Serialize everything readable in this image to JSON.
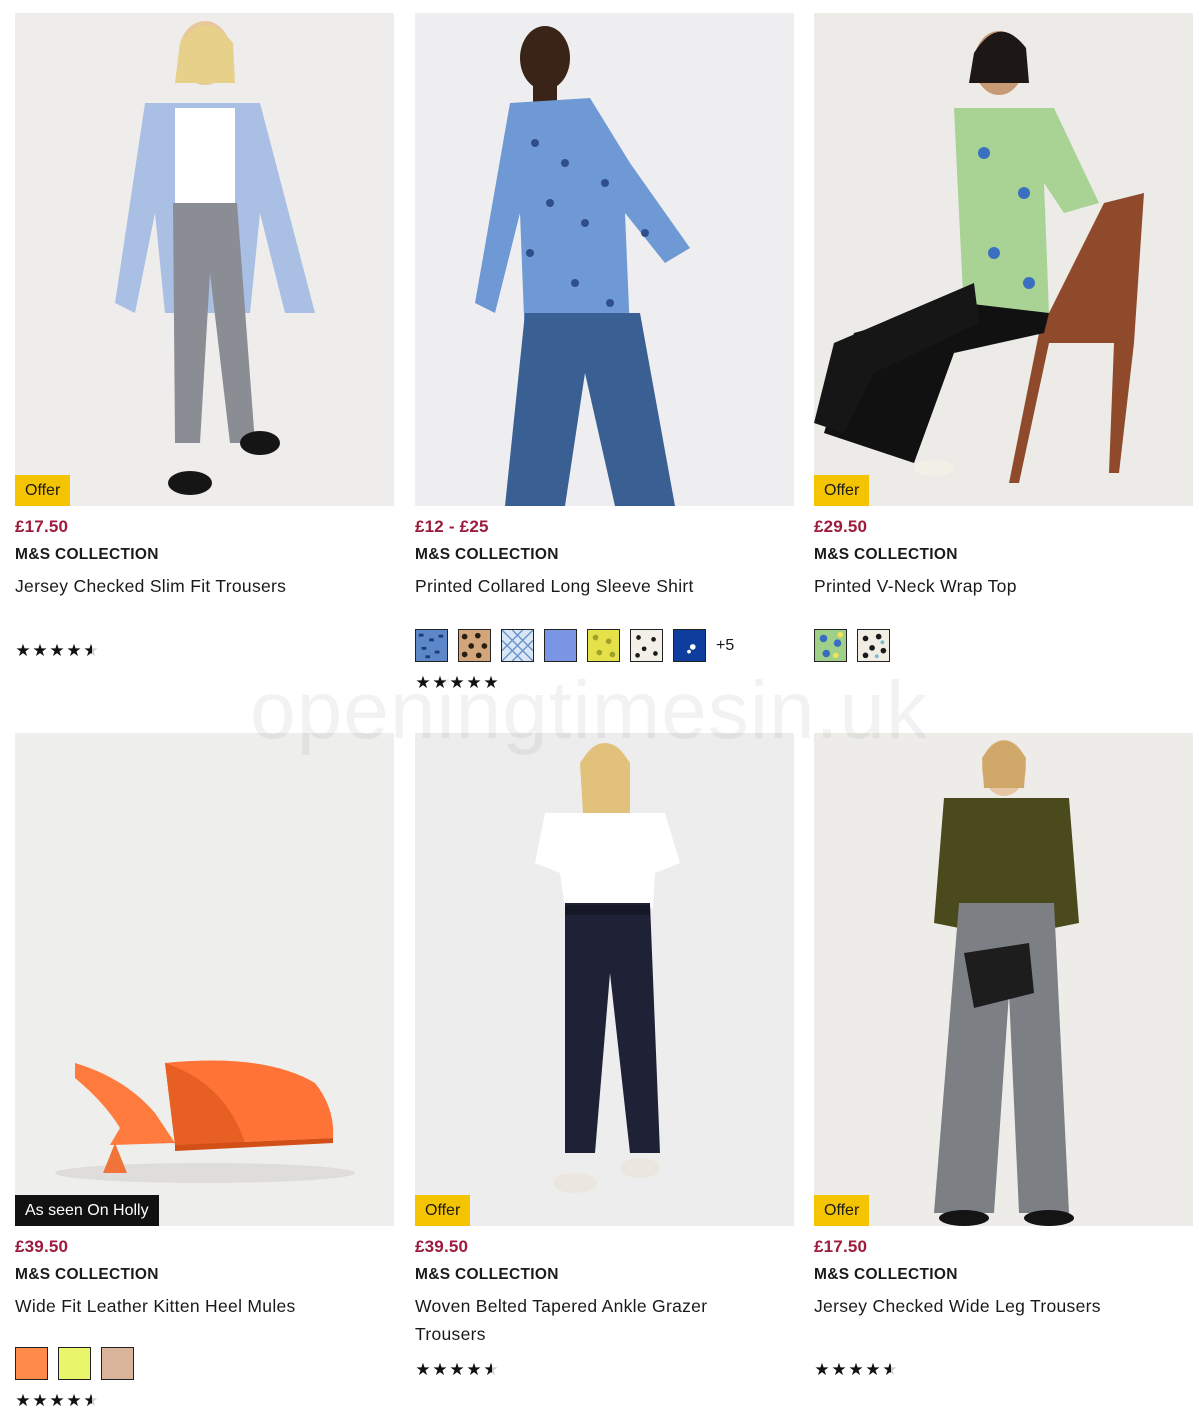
{
  "watermark": "openingtimesin.uk",
  "products": [
    {
      "badge": "Offer",
      "price": "£17.50",
      "brand": "M&S COLLECTION",
      "title": "Jersey Checked Slim Fit Trousers",
      "rating": 4.5,
      "swatches": [],
      "more_colours": ""
    },
    {
      "badge": "",
      "price": "£12 - £25",
      "brand": "M&S COLLECTION",
      "title": "Printed Collared Long Sleeve Shirt",
      "rating": 4.8,
      "swatches": [
        "blue-animal-print",
        "leopard-print",
        "blue-check",
        "periwinkle-blue",
        "yellow-floral",
        "white-polka-dot",
        "navy-floral"
      ],
      "more_colours": "+5"
    },
    {
      "badge": "Offer",
      "price": "£29.50",
      "brand": "M&S COLLECTION",
      "title": "Printed V-Neck Wrap Top",
      "rating": null,
      "swatches": [
        "green-floral",
        "animal-print"
      ],
      "more_colours": ""
    },
    {
      "badge": "As seen On Holly",
      "price": "£39.50",
      "brand": "M&S COLLECTION",
      "title": "Wide Fit Leather Kitten Heel Mules",
      "rating": 4.5,
      "swatches": [
        "#ff8a4a",
        "#e9f56a",
        "#d9b49a"
      ],
      "more_colours": ""
    },
    {
      "badge": "Offer",
      "price": "£39.50",
      "brand": "M&S COLLECTION",
      "title": "Woven Belted Tapered Ankle Grazer Trousers",
      "rating": 4.6,
      "swatches": [],
      "more_colours": ""
    },
    {
      "badge": "Offer",
      "price": "£17.50",
      "brand": "M&S COLLECTION",
      "title": "Jersey Checked Wide Leg Trousers",
      "rating": 4.6,
      "swatches": [],
      "more_colours": ""
    }
  ],
  "colors": {
    "price": "#9d1b3c",
    "offer_badge": "#f5c400",
    "black_badge": "#111111"
  }
}
